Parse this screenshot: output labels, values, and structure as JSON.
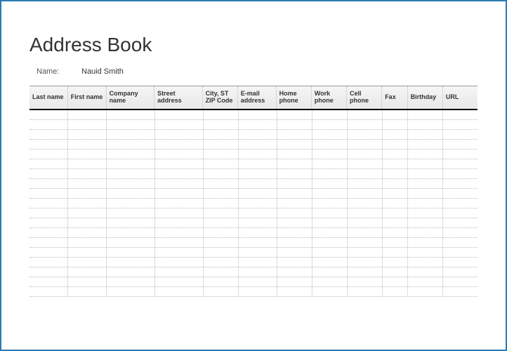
{
  "title": "Address Book",
  "owner": {
    "label": "Name:",
    "value": "Nauid Smith"
  },
  "columns": [
    "Last name",
    "First name",
    "Company name",
    "Street address",
    "City, ST ZIP Code",
    "E-mail address",
    "Home phone",
    "Work phone",
    "Cell phone",
    "Fax",
    "Birthday",
    "URL"
  ],
  "rows": [
    [
      "",
      "",
      "",
      "",
      "",
      "",
      "",
      "",
      "",
      "",
      "",
      ""
    ],
    [
      "",
      "",
      "",
      "",
      "",
      "",
      "",
      "",
      "",
      "",
      "",
      ""
    ],
    [
      "",
      "",
      "",
      "",
      "",
      "",
      "",
      "",
      "",
      "",
      "",
      ""
    ],
    [
      "",
      "",
      "",
      "",
      "",
      "",
      "",
      "",
      "",
      "",
      "",
      ""
    ],
    [
      "",
      "",
      "",
      "",
      "",
      "",
      "",
      "",
      "",
      "",
      "",
      ""
    ],
    [
      "",
      "",
      "",
      "",
      "",
      "",
      "",
      "",
      "",
      "",
      "",
      ""
    ],
    [
      "",
      "",
      "",
      "",
      "",
      "",
      "",
      "",
      "",
      "",
      "",
      ""
    ],
    [
      "",
      "",
      "",
      "",
      "",
      "",
      "",
      "",
      "",
      "",
      "",
      ""
    ],
    [
      "",
      "",
      "",
      "",
      "",
      "",
      "",
      "",
      "",
      "",
      "",
      ""
    ],
    [
      "",
      "",
      "",
      "",
      "",
      "",
      "",
      "",
      "",
      "",
      "",
      ""
    ],
    [
      "",
      "",
      "",
      "",
      "",
      "",
      "",
      "",
      "",
      "",
      "",
      ""
    ],
    [
      "",
      "",
      "",
      "",
      "",
      "",
      "",
      "",
      "",
      "",
      "",
      ""
    ],
    [
      "",
      "",
      "",
      "",
      "",
      "",
      "",
      "",
      "",
      "",
      "",
      ""
    ],
    [
      "",
      "",
      "",
      "",
      "",
      "",
      "",
      "",
      "",
      "",
      "",
      ""
    ],
    [
      "",
      "",
      "",
      "",
      "",
      "",
      "",
      "",
      "",
      "",
      "",
      ""
    ],
    [
      "",
      "",
      "",
      "",
      "",
      "",
      "",
      "",
      "",
      "",
      "",
      ""
    ],
    [
      "",
      "",
      "",
      "",
      "",
      "",
      "",
      "",
      "",
      "",
      "",
      ""
    ],
    [
      "",
      "",
      "",
      "",
      "",
      "",
      "",
      "",
      "",
      "",
      "",
      ""
    ],
    [
      "",
      "",
      "",
      "",
      "",
      "",
      "",
      "",
      "",
      "",
      "",
      ""
    ]
  ]
}
